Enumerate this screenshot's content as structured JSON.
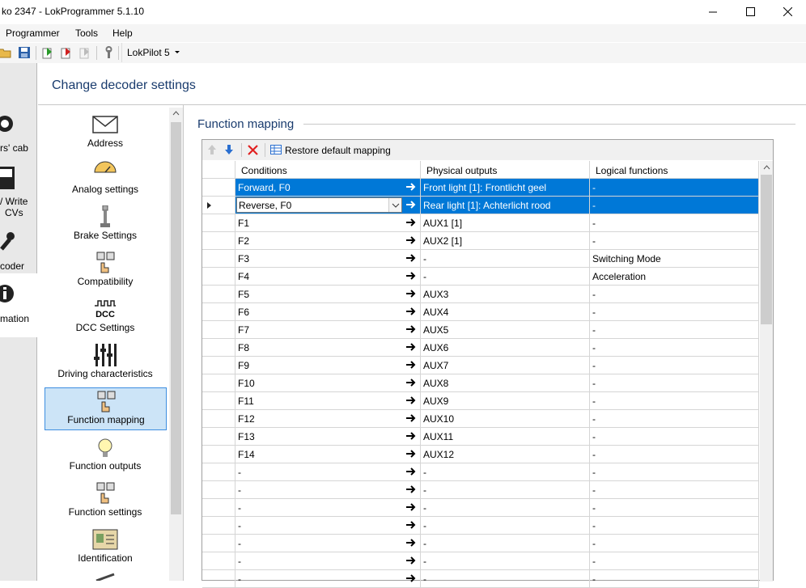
{
  "window": {
    "title": "ko 2347 - LokProgrammer 5.1.10",
    "minimize_icon": "minimize-icon",
    "maximize_icon": "maximize-icon",
    "close_icon": "close-icon"
  },
  "menu": [
    "Programmer",
    "Tools",
    "Help"
  ],
  "toolbar": {
    "decoder_select": "LokPilot 5"
  },
  "left_nav": {
    "items": [
      {
        "label_lines": [
          "rs' cab"
        ]
      },
      {
        "label_lines": [
          "/ Write",
          "CVs"
        ]
      },
      {
        "label_lines": [
          "coder"
        ]
      },
      {
        "label_lines": [
          "mation"
        ]
      }
    ]
  },
  "page_title": "Change decoder settings",
  "categories": [
    {
      "label": "Address",
      "icon": "envelope-icon"
    },
    {
      "label": "Analog settings",
      "icon": "gauge-icon"
    },
    {
      "label": "Brake Settings",
      "icon": "brake-lever-icon"
    },
    {
      "label": "Compatibility",
      "icon": "function-keys-icon"
    },
    {
      "label": "DCC Settings",
      "icon": "dcc-icon"
    },
    {
      "label": "Driving characteristics",
      "icon": "sliders-icon"
    },
    {
      "label": "Function mapping",
      "icon": "function-keys-icon",
      "selected": true
    },
    {
      "label": "Function outputs",
      "icon": "light-bulb-icon"
    },
    {
      "label": "Function settings",
      "icon": "function-keys-icon"
    },
    {
      "label": "Identification",
      "icon": "id-card-icon"
    }
  ],
  "section_title": "Function mapping",
  "grid_toolbar": {
    "restore_label": "Restore default mapping"
  },
  "columns": [
    "Conditions",
    "Physical outputs",
    "Logical functions"
  ],
  "rows": [
    {
      "cond": "Forward, F0",
      "phys": "Front light [1]: Frontlicht geel",
      "logic": "-",
      "highlight": true
    },
    {
      "cond": "Reverse, F0",
      "phys": "Rear light [1]: Achterlicht rood",
      "logic": "-",
      "highlight": true,
      "current": true
    },
    {
      "cond": "F1",
      "phys": "AUX1 [1]",
      "logic": "-"
    },
    {
      "cond": "F2",
      "phys": "AUX2 [1]",
      "logic": "-"
    },
    {
      "cond": "F3",
      "phys": "-",
      "logic": "Switching Mode"
    },
    {
      "cond": "F4",
      "phys": "-",
      "logic": "Acceleration"
    },
    {
      "cond": "F5",
      "phys": "AUX3",
      "logic": "-"
    },
    {
      "cond": "F6",
      "phys": "AUX4",
      "logic": "-"
    },
    {
      "cond": "F7",
      "phys": "AUX5",
      "logic": "-"
    },
    {
      "cond": "F8",
      "phys": "AUX6",
      "logic": "-"
    },
    {
      "cond": "F9",
      "phys": "AUX7",
      "logic": "-"
    },
    {
      "cond": "F10",
      "phys": "AUX8",
      "logic": "-"
    },
    {
      "cond": "F11",
      "phys": "AUX9",
      "logic": "-"
    },
    {
      "cond": "F12",
      "phys": "AUX10",
      "logic": "-"
    },
    {
      "cond": "F13",
      "phys": "AUX11",
      "logic": "-"
    },
    {
      "cond": "F14",
      "phys": "AUX12",
      "logic": "-"
    },
    {
      "cond": "-",
      "phys": "-",
      "logic": "-"
    },
    {
      "cond": "-",
      "phys": "-",
      "logic": "-"
    },
    {
      "cond": "-",
      "phys": "-",
      "logic": "-"
    },
    {
      "cond": "-",
      "phys": "-",
      "logic": "-"
    },
    {
      "cond": "-",
      "phys": "-",
      "logic": "-"
    },
    {
      "cond": "-",
      "phys": "-",
      "logic": "-"
    },
    {
      "cond": "-",
      "phys": "-",
      "logic": "-"
    }
  ],
  "colors": {
    "selection": "#0078d7",
    "category_selected_bg": "#cce4f7",
    "title_blue": "#1a3c6e"
  }
}
